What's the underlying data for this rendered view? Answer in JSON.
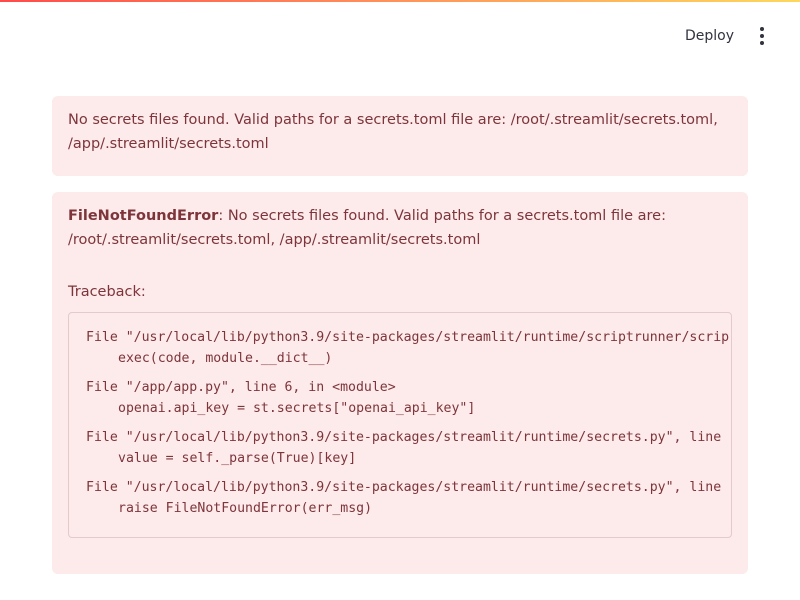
{
  "header": {
    "deploy_label": "Deploy",
    "menu_icon": "vertical-ellipsis-icon"
  },
  "colors": {
    "alert_background": "#fdeaea",
    "alert_text": "#7d353b",
    "top_gradient": [
      "#ff4b4b",
      "#fdd85d"
    ]
  },
  "secrets_alert": {
    "message": "No secrets files found. Valid paths for a secrets.toml file are: /root/.streamlit/secrets.toml, /app/.streamlit/secrets.toml"
  },
  "exception": {
    "name": "FileNotFoundError",
    "message": ": No secrets files found. Valid paths for a secrets.toml file are: /root/.streamlit/secrets.toml, /app/.streamlit/secrets.toml",
    "traceback_label": "Traceback:",
    "frames": [
      {
        "location": "File \"/usr/local/lib/python3.9/site-packages/streamlit/runtime/scriptrunner/scrip",
        "code": "exec(code, module.__dict__)"
      },
      {
        "location": "File \"/app/app.py\", line 6, in <module>",
        "code": "openai.api_key = st.secrets[\"openai_api_key\"]"
      },
      {
        "location": "File \"/usr/local/lib/python3.9/site-packages/streamlit/runtime/secrets.py\", line",
        "code": "value = self._parse(True)[key]"
      },
      {
        "location": "File \"/usr/local/lib/python3.9/site-packages/streamlit/runtime/secrets.py\", line",
        "code": "raise FileNotFoundError(err_msg)"
      }
    ]
  }
}
